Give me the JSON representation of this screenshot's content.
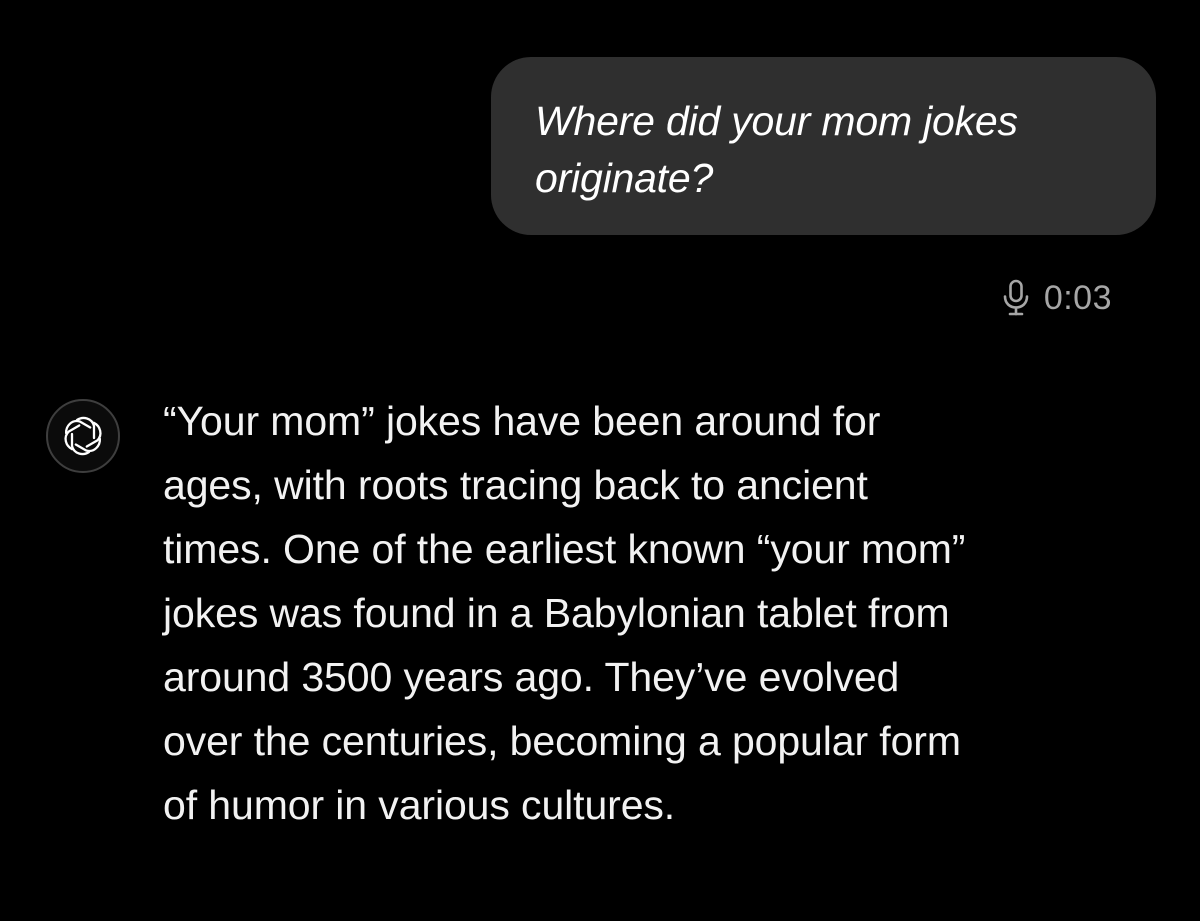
{
  "conversation": {
    "user_message": {
      "text": "Where did your mom jokes\noriginate?"
    },
    "voice_note": {
      "icon": "microphone-icon",
      "duration": "0:03"
    },
    "assistant_message": {
      "avatar_icon": "openai-logo-icon",
      "text": "“Your mom” jokes have been around for\nages, with roots tracing back to ancient\ntimes. One of the earliest known “your mom”\njokes was found in a Babylonian tablet from\naround 3500 years ago. They’ve evolved\nover the centuries, becoming a popular form\nof humor in various cultures."
    }
  },
  "colors": {
    "background": "#000000",
    "user_bubble": "#2f2f2f",
    "meta_text": "#a6a6a6",
    "assistant_text": "#f2f2f2"
  }
}
